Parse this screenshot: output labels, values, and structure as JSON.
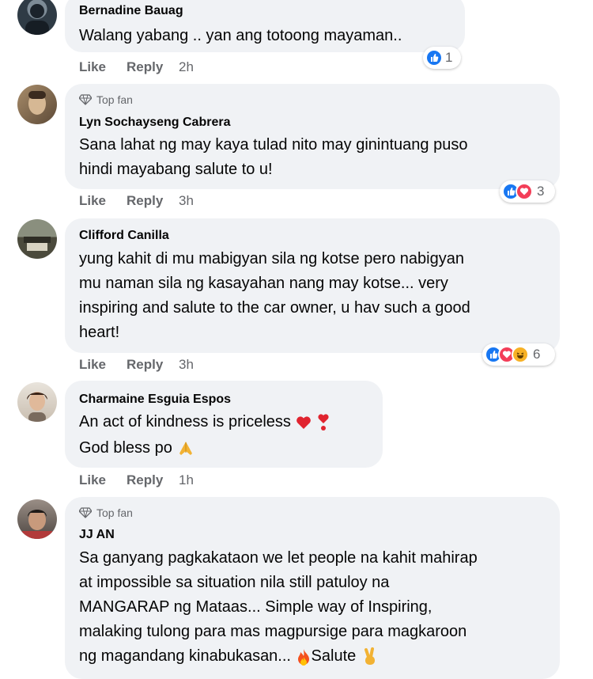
{
  "comments": [
    {
      "name": "Bernadine Bauag",
      "top_fan": "",
      "lines": [
        "Walang yabang .. yan ang totoong mayaman.."
      ],
      "like": "Like",
      "reply": "Reply",
      "time": "2h",
      "reaction_count": "1",
      "reactions": [
        "like"
      ]
    },
    {
      "name": "Lyn Sochayseng Cabrera",
      "top_fan": "Top fan",
      "lines": [
        "Sana lahat ng may kaya tulad nito may ginintuang puso",
        "hindi mayabang salute to u!"
      ],
      "like": "Like",
      "reply": "Reply",
      "time": "3h",
      "reaction_count": "3",
      "reactions": [
        "like",
        "love"
      ]
    },
    {
      "name": "Clifford Canilla",
      "top_fan": "",
      "lines": [
        "yung kahit di mu mabigyan sila ng kotse pero nabigyan",
        "mu naman sila ng kasayahan nang may kotse... very",
        "inspiring and salute to the car owner, u hav such a good",
        "heart!"
      ],
      "like": "Like",
      "reply": "Reply",
      "time": "3h",
      "reaction_count": "6",
      "reactions": [
        "like",
        "love",
        "haha"
      ]
    },
    {
      "name": "Charmaine Esguia Espos",
      "top_fan": "",
      "lines": [
        "An act of kindness is priceless",
        "God bless po"
      ],
      "like": "Like",
      "reply": "Reply",
      "time": "1h",
      "reaction_count": "",
      "reactions": []
    },
    {
      "name": "JJ AN",
      "top_fan": "Top fan",
      "lines": [
        "Sa ganyang pagkakataon we let people na kahit mahirap",
        "at impossible sa situation nila still patuloy na",
        "MANGARAP ng Mataas... Simple way of Inspiring,",
        "malaking tulong para mas magpursige para magkaroon",
        "ng magandang kinabukasan...",
        "Salute"
      ],
      "like": "",
      "reply": "",
      "time": "",
      "reaction_count": "",
      "reactions": []
    }
  ],
  "colors": {
    "bubble": "#f0f2f5",
    "meta": "#65676b",
    "like_blue": "#1877f2",
    "love_red": "#f33e58",
    "haha_yellow": "#f7b125"
  },
  "icons": [
    "top-fan-diamond-icon",
    "like-reaction-icon",
    "love-reaction-icon",
    "haha-reaction-icon",
    "heart-emoji-icon",
    "exclamation-heart-emoji-icon",
    "folded-hands-emoji-icon",
    "fire-emoji-icon",
    "victory-hand-emoji-icon"
  ]
}
